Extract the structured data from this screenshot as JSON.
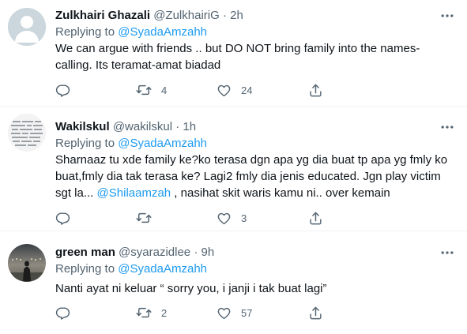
{
  "tweets": [
    {
      "name": "Zulkhairi Ghazali",
      "handle": "@ZulkhairiG",
      "dot": "·",
      "time": "2h",
      "replying_to_label": "Replying to",
      "replying_to": "@SyadaAmzahh",
      "text_lines": [
        "We can argue with friends .. but DO NOT bring family into the names-",
        "calling. Its teramat-amat biadad"
      ],
      "replies": "",
      "retweets": "4",
      "likes": "24"
    },
    {
      "name": "Wakilskul",
      "handle": "@wakilskul",
      "dot": "·",
      "time": "1h",
      "replying_to_label": "Replying to",
      "replying_to": "@SyadaAmzahh",
      "text_lines": [
        "Sharnaaz tu xde family ke?ko terasa dgn apa yg dia buat tp apa yg fmly ko",
        "buat,fmly dia tak terasa ke? Lagi2 fmly dia jenis educated. Jgn play victim"
      ],
      "text_line3_pre": "sgt la... ",
      "text_line3_mention": "@Shilaamzah",
      "text_line3_post": " , nasihat skit waris kamu ni.. over kemain",
      "replies": "",
      "retweets": "",
      "likes": "3"
    },
    {
      "name": "green man",
      "handle": "@syarazidlee",
      "dot": "·",
      "time": "9h",
      "replying_to_label": "Replying to",
      "replying_to": "@SyadaAmzahh",
      "text_lines": [
        "Nanti ayat ni keluar “ sorry you, i janji i tak buat lagi”"
      ],
      "replies": "",
      "retweets": "2",
      "likes": "57"
    }
  ],
  "icons": {
    "more": "more-horizontal-icon",
    "reply": "reply-icon",
    "retweet": "retweet-icon",
    "like": "heart-icon",
    "share": "share-icon"
  },
  "colors": {
    "link": "#1d9bf0",
    "muted": "#536471",
    "text": "#0f1419"
  }
}
